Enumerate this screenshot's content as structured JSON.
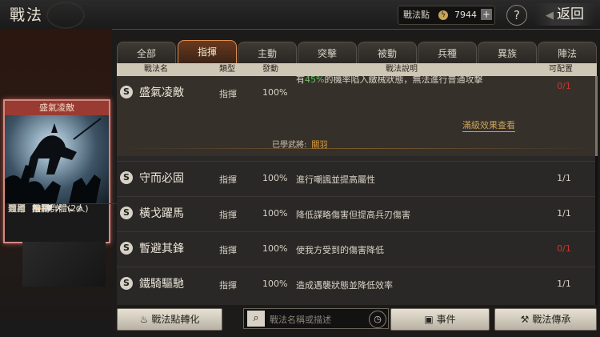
{
  "header": {
    "title": "戰法",
    "points_label": "戰法點",
    "points_icon": "lightning-coin-icon",
    "points_value": "7944",
    "help_label": "?",
    "back_label": "返回"
  },
  "card": {
    "name": "盛氣凌敵",
    "rows": [
      {
        "key": "適用",
        "value": "🐎 ⛊ ✗ ↘ ⊛"
      },
      {
        "key": "類型",
        "value": "指揮"
      },
      {
        "key": "效果",
        "value": "控制"
      },
      {
        "key": "目標",
        "value": "敵軍群體(2人)"
      }
    ]
  },
  "tabs": [
    "全部",
    "指揮",
    "主動",
    "突擊",
    "被動",
    "兵種",
    "異族",
    "陣法"
  ],
  "active_tab": "指揮",
  "columns": {
    "name": "戰法名",
    "type": "類型",
    "rate": "發動",
    "desc": "戰法說明",
    "alloc": "可配置"
  },
  "expanded": {
    "badge": "S",
    "name": "盛氣凌敵",
    "type": "指揮",
    "rate": "100%",
    "desc_prefix": "有",
    "desc_highlight": "45%",
    "desc_suffix": "的機率陷入繳械狀態，無法進行普通攻擊",
    "alloc": "0/1",
    "full_effect_link": "滿級效果查看",
    "learned_label": "已學武將:",
    "learned_name": "關羽"
  },
  "skills": [
    {
      "badge": "S",
      "name": "守而必固",
      "type": "指揮",
      "rate": "100%",
      "desc": "進行嘲諷並提高屬性",
      "alloc": "1/1",
      "alloc_red": false
    },
    {
      "badge": "S",
      "name": "橫戈躍馬",
      "type": "指揮",
      "rate": "100%",
      "desc": "降低謀略傷害但提高兵刃傷害",
      "alloc": "1/1",
      "alloc_red": false
    },
    {
      "badge": "S",
      "name": "暫避其鋒",
      "type": "指揮",
      "rate": "100%",
      "desc": "使我方受到的傷害降低",
      "alloc": "0/1",
      "alloc_red": true
    },
    {
      "badge": "S",
      "name": "鐵騎驅馳",
      "type": "指揮",
      "rate": "100%",
      "desc": "造成遇襲狀態並降低效率",
      "alloc": "1/1",
      "alloc_red": false
    }
  ],
  "footer": {
    "convert_label": "戰法點轉化",
    "convert_icon": "flame-icon",
    "search_placeholder": "戰法名稱或描述",
    "search_icon": "magnifier-icon",
    "sort_icon": "clock-icon",
    "event_label": "事件",
    "event_icon": "scroll-icon",
    "inherit_label": "戰法傳承",
    "inherit_icon": "hammer-icon"
  },
  "colors": {
    "accent_orange": "#e09050",
    "alloc_red": "#c8382c",
    "highlight_green": "#6cc36c",
    "link_gold": "#c9a45a"
  }
}
